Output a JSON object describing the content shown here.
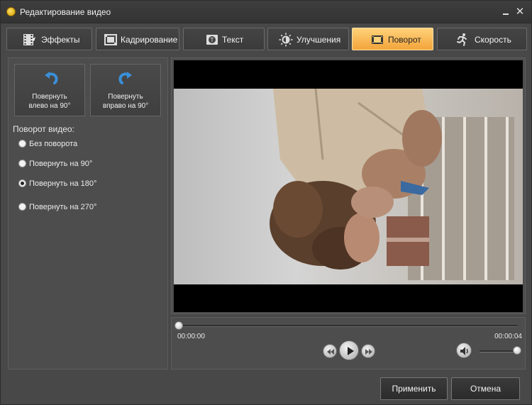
{
  "window": {
    "title": "Редактирование видео"
  },
  "tabs": [
    {
      "label": "Эффекты",
      "icon": "film-effects-icon",
      "active": false
    },
    {
      "label": "Кадрирование",
      "icon": "crop-film-icon",
      "active": false
    },
    {
      "label": "Текст",
      "icon": "text-icon",
      "active": false
    },
    {
      "label": "Улучшения",
      "icon": "sun-brightness-icon",
      "active": false
    },
    {
      "label": "Поворот",
      "icon": "rotate-film-icon",
      "active": true
    },
    {
      "label": "Скорость",
      "icon": "running-man-icon",
      "active": false
    }
  ],
  "rotate_buttons": {
    "left": {
      "line1": "Повернуть",
      "line2": "влево  на 90°"
    },
    "right": {
      "line1": "Повернуть",
      "line2": "вправо на 90°"
    }
  },
  "rotation": {
    "label": "Поворот видео:",
    "options": [
      "Без поворота",
      "Повернуть на 90°",
      "Повернуть на 180°",
      "Повернуть на 270°"
    ],
    "selected": "Повернуть на 180°"
  },
  "player": {
    "time_start": "00:00:00",
    "time_end": "00:00:04",
    "seek_position": 0,
    "volume": 1
  },
  "footer": {
    "apply_label": "Применить",
    "cancel_label": "Отмена"
  },
  "colors": {
    "accent_tab": "#f3a43a",
    "rotate_arrow": "#3a8fd8",
    "background": "#484848"
  }
}
